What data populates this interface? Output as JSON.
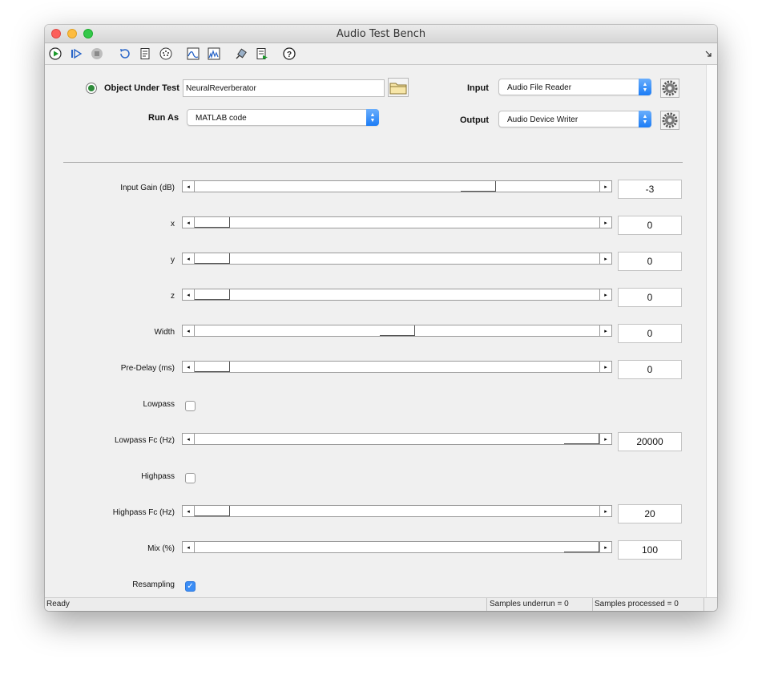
{
  "window": {
    "title": "Audio Test Bench"
  },
  "toolbar": {
    "icons": [
      "run-icon",
      "step-icon",
      "stop-icon",
      "reset-icon",
      "generate-code-icon",
      "midi-icon",
      "time-scope-icon",
      "spectrum-analyzer-icon",
      "plugin-icon",
      "export-icon",
      "help-icon"
    ]
  },
  "header": {
    "object_under_test_label": "Object Under Test",
    "object_under_test_value": "NeuralReverberator",
    "run_as_label": "Run As",
    "run_as_value": "MATLAB code",
    "input_label": "Input",
    "input_value": "Audio File Reader",
    "output_label": "Output",
    "output_value": "Audio Device Writer"
  },
  "params": [
    {
      "label": "Input Gain (dB)",
      "value": "-3",
      "level": 0.72
    },
    {
      "label": "x",
      "value": "0",
      "level": 0.0
    },
    {
      "label": "y",
      "value": "0",
      "level": 0.0
    },
    {
      "label": "z",
      "value": "0",
      "level": 0.0
    },
    {
      "label": "Width",
      "value": "0",
      "level": 0.5
    },
    {
      "label": "Pre-Delay (ms)",
      "value": "0",
      "level": 0.0
    },
    {
      "label": "Lowpass",
      "checked": false
    },
    {
      "label": "Lowpass Fc (Hz)",
      "value": "20000",
      "level": 1.0
    },
    {
      "label": "Highpass",
      "checked": false
    },
    {
      "label": "Highpass Fc (Hz)",
      "value": "20",
      "level": 0.0
    },
    {
      "label": "Mix (%)",
      "value": "100",
      "level": 1.0
    },
    {
      "label": "Resampling",
      "checked": true
    }
  ],
  "status": {
    "ready": "Ready",
    "underrun": "Samples underrun = 0",
    "processed": "Samples processed = 0"
  },
  "colors": {
    "accent": "#1b7cf6",
    "status_led": "#2e8b3a"
  }
}
